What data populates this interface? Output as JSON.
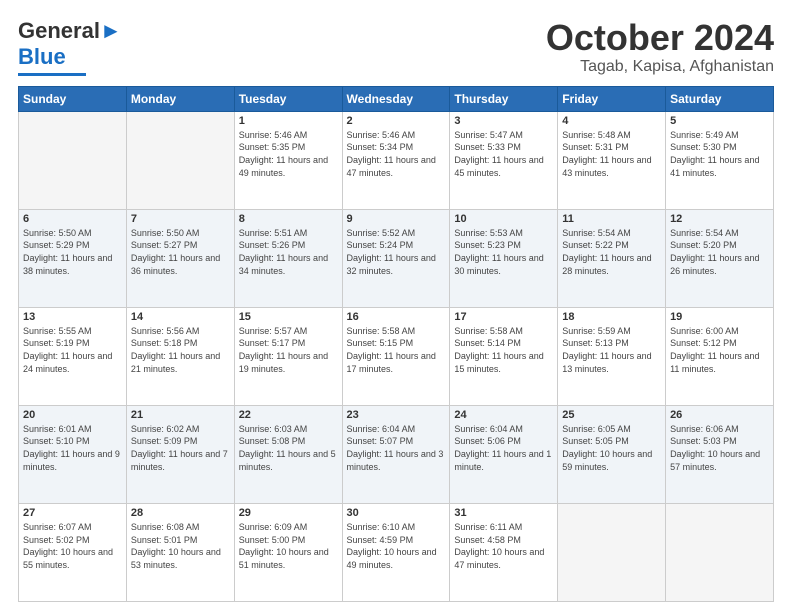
{
  "logo": {
    "line1": "General",
    "line2": "Blue"
  },
  "header": {
    "month": "October 2024",
    "location": "Tagab, Kapisa, Afghanistan"
  },
  "weekdays": [
    "Sunday",
    "Monday",
    "Tuesday",
    "Wednesday",
    "Thursday",
    "Friday",
    "Saturday"
  ],
  "weeks": [
    [
      {
        "day": "",
        "info": ""
      },
      {
        "day": "",
        "info": ""
      },
      {
        "day": "1",
        "info": "Sunrise: 5:46 AM\nSunset: 5:35 PM\nDaylight: 11 hours and 49 minutes."
      },
      {
        "day": "2",
        "info": "Sunrise: 5:46 AM\nSunset: 5:34 PM\nDaylight: 11 hours and 47 minutes."
      },
      {
        "day": "3",
        "info": "Sunrise: 5:47 AM\nSunset: 5:33 PM\nDaylight: 11 hours and 45 minutes."
      },
      {
        "day": "4",
        "info": "Sunrise: 5:48 AM\nSunset: 5:31 PM\nDaylight: 11 hours and 43 minutes."
      },
      {
        "day": "5",
        "info": "Sunrise: 5:49 AM\nSunset: 5:30 PM\nDaylight: 11 hours and 41 minutes."
      }
    ],
    [
      {
        "day": "6",
        "info": "Sunrise: 5:50 AM\nSunset: 5:29 PM\nDaylight: 11 hours and 38 minutes."
      },
      {
        "day": "7",
        "info": "Sunrise: 5:50 AM\nSunset: 5:27 PM\nDaylight: 11 hours and 36 minutes."
      },
      {
        "day": "8",
        "info": "Sunrise: 5:51 AM\nSunset: 5:26 PM\nDaylight: 11 hours and 34 minutes."
      },
      {
        "day": "9",
        "info": "Sunrise: 5:52 AM\nSunset: 5:24 PM\nDaylight: 11 hours and 32 minutes."
      },
      {
        "day": "10",
        "info": "Sunrise: 5:53 AM\nSunset: 5:23 PM\nDaylight: 11 hours and 30 minutes."
      },
      {
        "day": "11",
        "info": "Sunrise: 5:54 AM\nSunset: 5:22 PM\nDaylight: 11 hours and 28 minutes."
      },
      {
        "day": "12",
        "info": "Sunrise: 5:54 AM\nSunset: 5:20 PM\nDaylight: 11 hours and 26 minutes."
      }
    ],
    [
      {
        "day": "13",
        "info": "Sunrise: 5:55 AM\nSunset: 5:19 PM\nDaylight: 11 hours and 24 minutes."
      },
      {
        "day": "14",
        "info": "Sunrise: 5:56 AM\nSunset: 5:18 PM\nDaylight: 11 hours and 21 minutes."
      },
      {
        "day": "15",
        "info": "Sunrise: 5:57 AM\nSunset: 5:17 PM\nDaylight: 11 hours and 19 minutes."
      },
      {
        "day": "16",
        "info": "Sunrise: 5:58 AM\nSunset: 5:15 PM\nDaylight: 11 hours and 17 minutes."
      },
      {
        "day": "17",
        "info": "Sunrise: 5:58 AM\nSunset: 5:14 PM\nDaylight: 11 hours and 15 minutes."
      },
      {
        "day": "18",
        "info": "Sunrise: 5:59 AM\nSunset: 5:13 PM\nDaylight: 11 hours and 13 minutes."
      },
      {
        "day": "19",
        "info": "Sunrise: 6:00 AM\nSunset: 5:12 PM\nDaylight: 11 hours and 11 minutes."
      }
    ],
    [
      {
        "day": "20",
        "info": "Sunrise: 6:01 AM\nSunset: 5:10 PM\nDaylight: 11 hours and 9 minutes."
      },
      {
        "day": "21",
        "info": "Sunrise: 6:02 AM\nSunset: 5:09 PM\nDaylight: 11 hours and 7 minutes."
      },
      {
        "day": "22",
        "info": "Sunrise: 6:03 AM\nSunset: 5:08 PM\nDaylight: 11 hours and 5 minutes."
      },
      {
        "day": "23",
        "info": "Sunrise: 6:04 AM\nSunset: 5:07 PM\nDaylight: 11 hours and 3 minutes."
      },
      {
        "day": "24",
        "info": "Sunrise: 6:04 AM\nSunset: 5:06 PM\nDaylight: 11 hours and 1 minute."
      },
      {
        "day": "25",
        "info": "Sunrise: 6:05 AM\nSunset: 5:05 PM\nDaylight: 10 hours and 59 minutes."
      },
      {
        "day": "26",
        "info": "Sunrise: 6:06 AM\nSunset: 5:03 PM\nDaylight: 10 hours and 57 minutes."
      }
    ],
    [
      {
        "day": "27",
        "info": "Sunrise: 6:07 AM\nSunset: 5:02 PM\nDaylight: 10 hours and 55 minutes."
      },
      {
        "day": "28",
        "info": "Sunrise: 6:08 AM\nSunset: 5:01 PM\nDaylight: 10 hours and 53 minutes."
      },
      {
        "day": "29",
        "info": "Sunrise: 6:09 AM\nSunset: 5:00 PM\nDaylight: 10 hours and 51 minutes."
      },
      {
        "day": "30",
        "info": "Sunrise: 6:10 AM\nSunset: 4:59 PM\nDaylight: 10 hours and 49 minutes."
      },
      {
        "day": "31",
        "info": "Sunrise: 6:11 AM\nSunset: 4:58 PM\nDaylight: 10 hours and 47 minutes."
      },
      {
        "day": "",
        "info": ""
      },
      {
        "day": "",
        "info": ""
      }
    ]
  ]
}
